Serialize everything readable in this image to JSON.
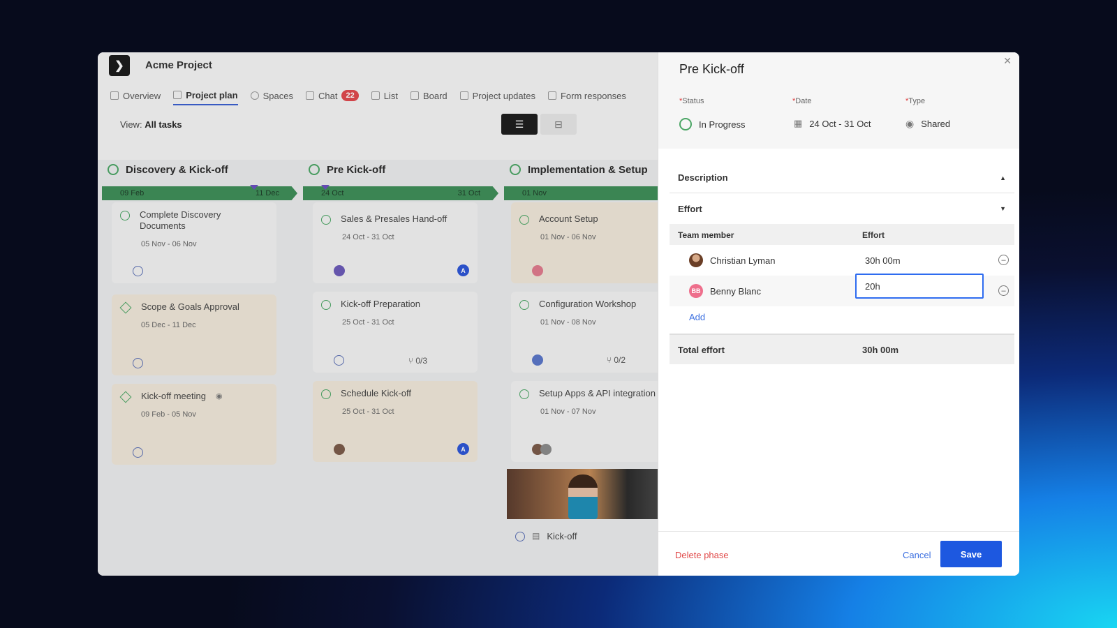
{
  "project": {
    "title": "Acme Project"
  },
  "tabs": [
    {
      "label": "Overview"
    },
    {
      "label": "Project plan"
    },
    {
      "label": "Spaces"
    },
    {
      "label": "Chat",
      "badge": "22"
    },
    {
      "label": "List"
    },
    {
      "label": "Board"
    },
    {
      "label": "Project updates"
    },
    {
      "label": "Form responses"
    }
  ],
  "view": {
    "prefix": "View:",
    "value": "All tasks"
  },
  "phases": [
    {
      "title": "Discovery & Kick-off",
      "start": "09 Feb",
      "end": "11 Dec",
      "cards": [
        {
          "title": "Complete Discovery Documents",
          "dates": "05 Nov - 06 Nov"
        },
        {
          "title": "Scope & Goals Approval",
          "dates": "05 Dec - 11 Dec"
        },
        {
          "title": "Kick-off meeting",
          "dates": "09 Feb - 05 Nov"
        }
      ]
    },
    {
      "title": "Pre Kick-off",
      "start": "24 Oct",
      "end": "31 Oct",
      "cards": [
        {
          "title": "Sales & Presales Hand-off",
          "dates": "24 Oct - 31 Oct",
          "avatar": "A"
        },
        {
          "title": "Kick-off Preparation",
          "dates": "25 Oct - 31 Oct",
          "subtasks": "0/3"
        },
        {
          "title": "Schedule Kick-off",
          "dates": "25 Oct - 31 Oct",
          "avatar": "A"
        }
      ]
    },
    {
      "title": "Implementation & Setup",
      "start": "01 Nov",
      "end": "",
      "cards": [
        {
          "title": "Account Setup",
          "dates": "01 Nov - 06 Nov"
        },
        {
          "title": "Configuration Workshop",
          "dates": "01 Nov - 08 Nov",
          "subtasks": "0/2"
        },
        {
          "title": "Setup Apps & API integration",
          "dates": "01 Nov - 07 Nov"
        }
      ]
    }
  ],
  "bottom_task": {
    "label": "Kick-off"
  },
  "panel": {
    "title": "Pre Kick-off",
    "fields": {
      "status": {
        "label": "Status",
        "value": "In Progress"
      },
      "date": {
        "label": "Date",
        "value": "24 Oct - 31 Oct"
      },
      "type": {
        "label": "Type",
        "value": "Shared"
      }
    },
    "description_label": "Description",
    "effort_label": "Effort",
    "table": {
      "col_member": "Team member",
      "col_effort": "Effort",
      "rows": [
        {
          "name": "Christian Lyman",
          "effort": "30h 00m"
        },
        {
          "name": "Benny Blanc",
          "initials": "BB",
          "effort_input": "20h"
        }
      ]
    },
    "add_label": "Add",
    "total_label": "Total effort",
    "total_value": "30h 00m",
    "delete_label": "Delete phase",
    "cancel_label": "Cancel",
    "save_label": "Save"
  },
  "colors": {
    "accent": "#1d58e0",
    "danger": "#e04848",
    "success": "#4aa564"
  }
}
